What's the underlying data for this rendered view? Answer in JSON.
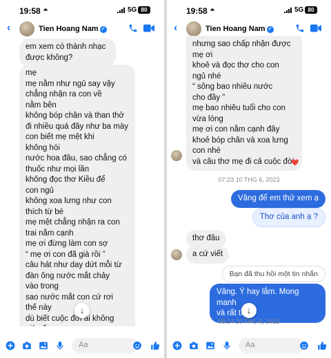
{
  "colors": {
    "accent": "#1877f2",
    "bubble_out": "#2d6cdf",
    "bubble_in": "#efefef"
  },
  "status": {
    "time": "19:58",
    "network": "5G",
    "battery": "80"
  },
  "header": {
    "contact_name": "Tien Hoang Nam"
  },
  "left": {
    "messages": [
      {
        "text": "em xem có thành nhạc\nđược không?"
      },
      {
        "text": "mẹ\nmẹ nằm như ngủ say vậy\nchẳng nhận ra con về\nnằm bên\nkhông bóp chân và than thở\nđi nhiều quá đây như ba mày\ncon biết mẹ mệt khi\nkhông hỏi\nnước hoa đâu, sao chẳng có\nthuốc như mọi lần\nkhông đọc thơ Kiều để\ncon ngủ\nkhông xoa lưng như con\nthích từ bé\nmẹ mệt chẳng nhận ra con\ntrai nằm cạnh\nmẹ ơi đừng làm con sợ\n“ mẹ ơi con đã già rồi ”\ncâu hát như day dứt mỗi từ\nđàn ông nước mắt chảy\nvào trong\nsao nước mắt con cứ rơi\nthế này\ndù biết cuộc đời ai không\ngià yếu\nnhưng sao chấp nhận được"
      }
    ],
    "composer_placeholder": "Aa"
  },
  "right": {
    "long_message": "nhưng sao chấp nhận được\nmẹ ơi\nkhoẻ và đọc thơ cho con\nngủ nhé\n“ sông bao nhiêu nước\ncho đầy ”\nmẹ bao nhiêu tuổi cho con\nvừa lòng\nmẹ ơi con nằm cạnh đây\nkhoẻ bóp chân và xoa lưng\ncon nhé\nvà câu thơ mẹ đi cả cuộc đời",
    "reaction": "❤️",
    "timestamp_1": "07:23 10 THG 6, 2023",
    "out_1": "Vâng để em thử xem ạ",
    "out_2": "Thơ của anh ạ ?",
    "in_1": "thơ đâu",
    "in_2": "a cứ viết",
    "unsent_notice": "Bạn đã thu hồi một tin nhắn",
    "out_3": "Vâng. Ý hay lắm. Mong manh\nvà rất tình",
    "timestamp_2": "08:14 10 THG 6, 2023",
    "composer_placeholder": "Aa"
  },
  "icons": {
    "back": "chevron-left-icon",
    "call": "phone-icon",
    "video": "video-camera-icon",
    "scroll": "arrow-down-icon"
  }
}
